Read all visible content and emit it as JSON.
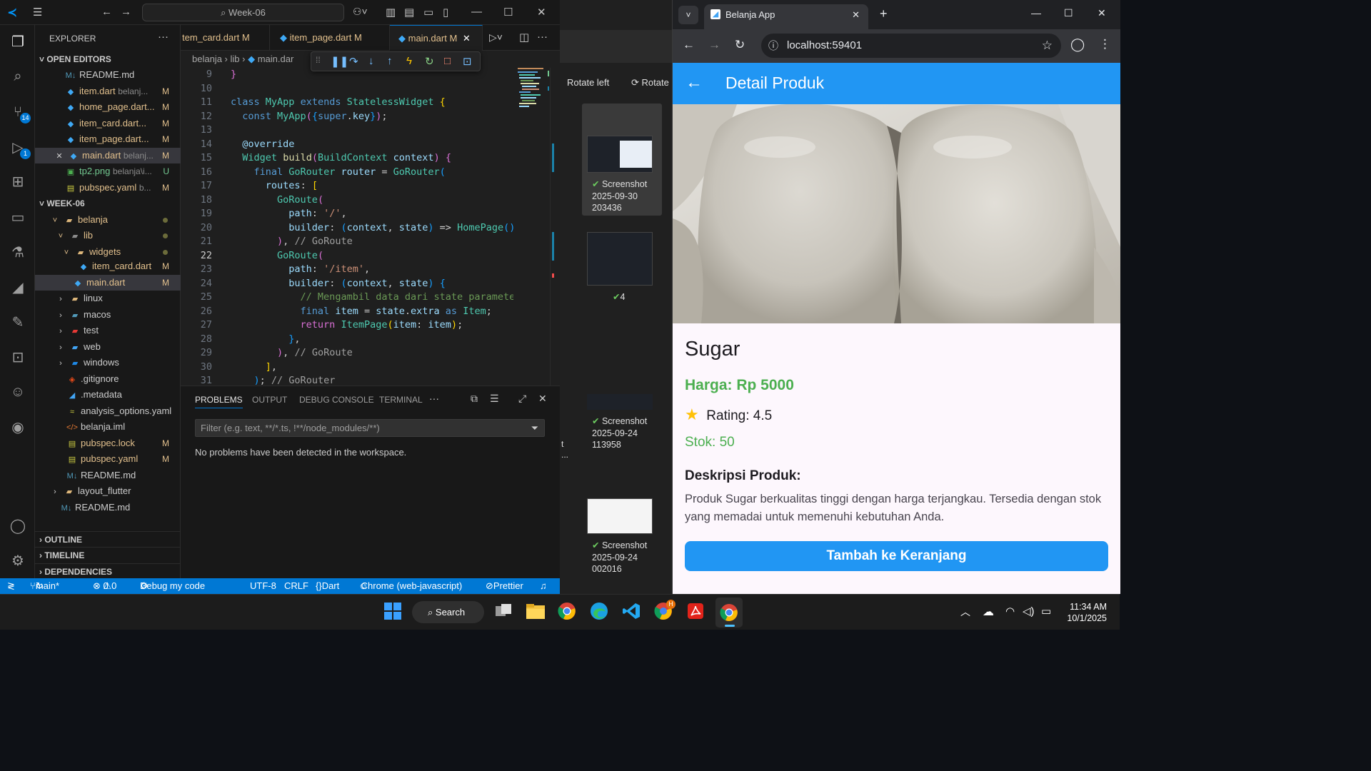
{
  "vscode": {
    "search": "Week-06",
    "explorer_title": "EXPLORER",
    "open_editors_label": "OPEN EDITORS",
    "open_editors": [
      {
        "name": "README.md",
        "sub": "",
        "status": ""
      },
      {
        "name": "item.dart",
        "sub": "belanj...",
        "status": "M"
      },
      {
        "name": "home_page.dart...",
        "sub": "",
        "status": "M"
      },
      {
        "name": "item_card.dart...",
        "sub": "",
        "status": "M"
      },
      {
        "name": "item_page.dart...",
        "sub": "",
        "status": "M"
      },
      {
        "name": "main.dart",
        "sub": "belanj...",
        "status": "M"
      },
      {
        "name": "tp2.png",
        "sub": "belanja\\i...",
        "status": "U"
      },
      {
        "name": "pubspec.yaml",
        "sub": "b...",
        "status": "M"
      }
    ],
    "workspace_label": "WEEK-06",
    "tree": [
      {
        "name": "belanja",
        "status": ""
      },
      {
        "name": "lib",
        "status": ""
      },
      {
        "name": "widgets",
        "status": ""
      },
      {
        "name": "item_card.dart",
        "status": "M"
      },
      {
        "name": "main.dart",
        "status": "M"
      },
      {
        "name": "linux",
        "status": ""
      },
      {
        "name": "macos",
        "status": ""
      },
      {
        "name": "test",
        "status": ""
      },
      {
        "name": "web",
        "status": ""
      },
      {
        "name": "windows",
        "status": ""
      },
      {
        "name": ".gitignore",
        "status": ""
      },
      {
        "name": ".metadata",
        "status": ""
      },
      {
        "name": "analysis_options.yaml",
        "status": ""
      },
      {
        "name": "belanja.iml",
        "status": ""
      },
      {
        "name": "pubspec.lock",
        "status": "M"
      },
      {
        "name": "pubspec.yaml",
        "status": "M"
      },
      {
        "name": "README.md",
        "status": ""
      },
      {
        "name": "layout_flutter",
        "status": ""
      },
      {
        "name": "README.md",
        "status": ""
      }
    ],
    "outline_label": "OUTLINE",
    "timeline_label": "TIMELINE",
    "dependencies_label": "DEPENDENCIES",
    "tabs": [
      {
        "name": "tem_card.dart",
        "status": "M"
      },
      {
        "name": "item_page.dart",
        "status": "M"
      },
      {
        "name": "main.dart",
        "status": "M"
      }
    ],
    "breadcrumb": [
      "belanja",
      "lib",
      "main.dar"
    ],
    "line_numbers": [
      "9",
      "10",
      "11",
      "12",
      "13",
      "14",
      "15",
      "16",
      "17",
      "18",
      "19",
      "20",
      "21",
      "22",
      "23",
      "24",
      "25",
      "26",
      "27",
      "28",
      "29",
      "30",
      "31"
    ],
    "panel_tabs": [
      "PROBLEMS",
      "OUTPUT",
      "DEBUG CONSOLE",
      "TERMINAL"
    ],
    "filter_placeholder": "Filter (e.g. text, **/*.ts, !**/node_modules/**)",
    "problems_message": "No problems have been detected in the workspace.",
    "status": {
      "branch": "main*",
      "problems": "0",
      "warnings": "0",
      "debug": "Debug my code",
      "encoding": "UTF-8",
      "eol": "CRLF",
      "language": "Dart",
      "device": "Chrome (web-javascript)",
      "prettier": "Prettier"
    },
    "badges": {
      "scm": "14",
      "debug": "1"
    }
  },
  "photos": {
    "rotate_left": "Rotate left",
    "rotate_right": "Rotate",
    "items": [
      {
        "title": "Screenshot",
        "date": "2025-09-30",
        "time": "203436"
      },
      {
        "title": "",
        "date": "",
        "time": "",
        "count": "4"
      },
      {
        "title": "Screenshot",
        "date": "2025-09-24",
        "time": "113958"
      },
      {
        "title": "Screenshot",
        "date": "2025-09-24",
        "time": "002016"
      }
    ],
    "side_text_1": "t",
    "side_text_2": "..."
  },
  "chrome": {
    "tab_title": "Belanja App",
    "url": "localhost:59401",
    "app_title": "Detail Produk",
    "product": {
      "name": "Sugar",
      "price": "Harga: Rp 5000",
      "rating": "Rating: 4.5",
      "stock": "Stok: 50",
      "desc_title": "Deskripsi Produk:",
      "description": "Produk Sugar berkualitas tinggi dengan harga terjangkau. Tersedia dengan stok yang memadai untuk memenuhi kebutuhan Anda."
    },
    "button": "Tambah ke Keranjang",
    "colors": {
      "primary": "#2196f3",
      "price": "#4caf50",
      "star": "#ffc107"
    }
  },
  "taskbar": {
    "search": "Search",
    "time": "11:34 AM",
    "date": "10/1/2025",
    "badge": "H"
  }
}
